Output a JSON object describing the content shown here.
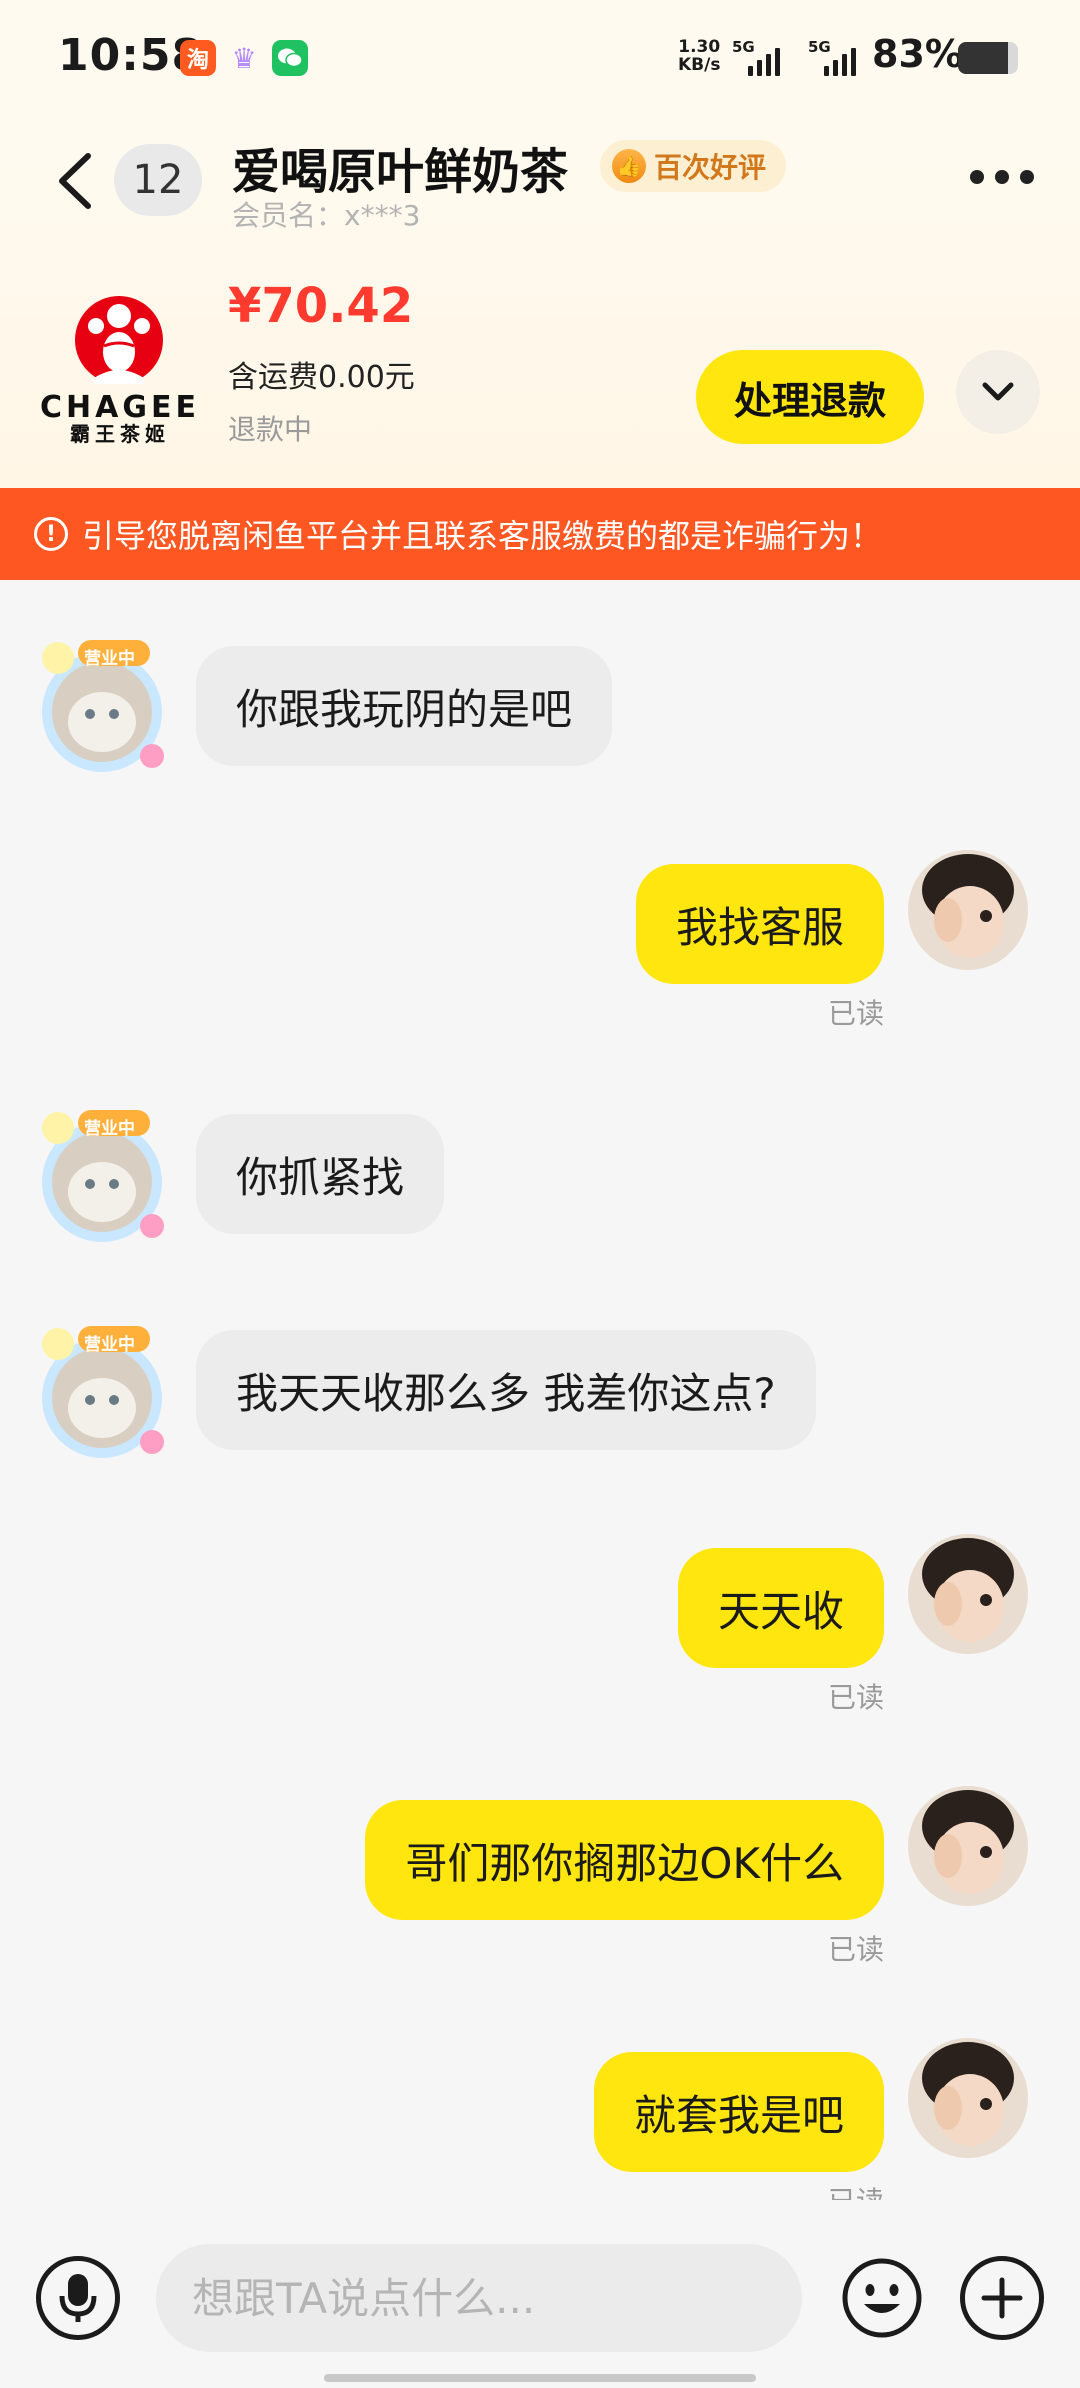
{
  "status_bar": {
    "time": "10:58",
    "app_icons": [
      "taobao-icon",
      "crown-icon",
      "wechat-icon"
    ],
    "net_speed_value": "1.30",
    "net_speed_unit": "KB/s",
    "signal_1_label": "5G",
    "signal_2_label": "5G",
    "battery_text": "83%",
    "battery_level": 0.83
  },
  "header": {
    "unread_count": "12",
    "shop_name": "爱喝原叶鲜奶茶",
    "badge_label": "百次好评",
    "member_label": "会员名：x***3"
  },
  "order": {
    "brand_logo_text": "CHAGEE",
    "brand_logo_sub": "霸王茶姬",
    "price": "¥70.42",
    "shipping": "含运费0.00元",
    "status": "退款中",
    "refund_button": "处理退款"
  },
  "warning": {
    "text": "引导您脱离闲鱼平台并且联系客服缴费的都是诈骗行为！"
  },
  "messages": [
    {
      "side": "in",
      "text": "你跟我玩阴的是吧",
      "avatar_badge": "营业中"
    },
    {
      "side": "out",
      "text": "我找客服",
      "read": "已读"
    },
    {
      "side": "in",
      "text": "你抓紧找",
      "avatar_badge": "营业中"
    },
    {
      "side": "in",
      "text": "我天天收那么多 我差你这点?",
      "avatar_badge": "营业中"
    },
    {
      "side": "out",
      "text": "天天收",
      "read": "已读"
    },
    {
      "side": "out",
      "text": "哥们那你搁那边OK什么",
      "read": "已读"
    },
    {
      "side": "out",
      "text": "就套我是吧",
      "read": "已读"
    }
  ],
  "input_bar": {
    "placeholder": "想跟TA说点什么..."
  },
  "colors": {
    "accent_yellow": "#ffe60f",
    "warning_orange": "#ff5722",
    "price_red": "#ff3b30"
  }
}
